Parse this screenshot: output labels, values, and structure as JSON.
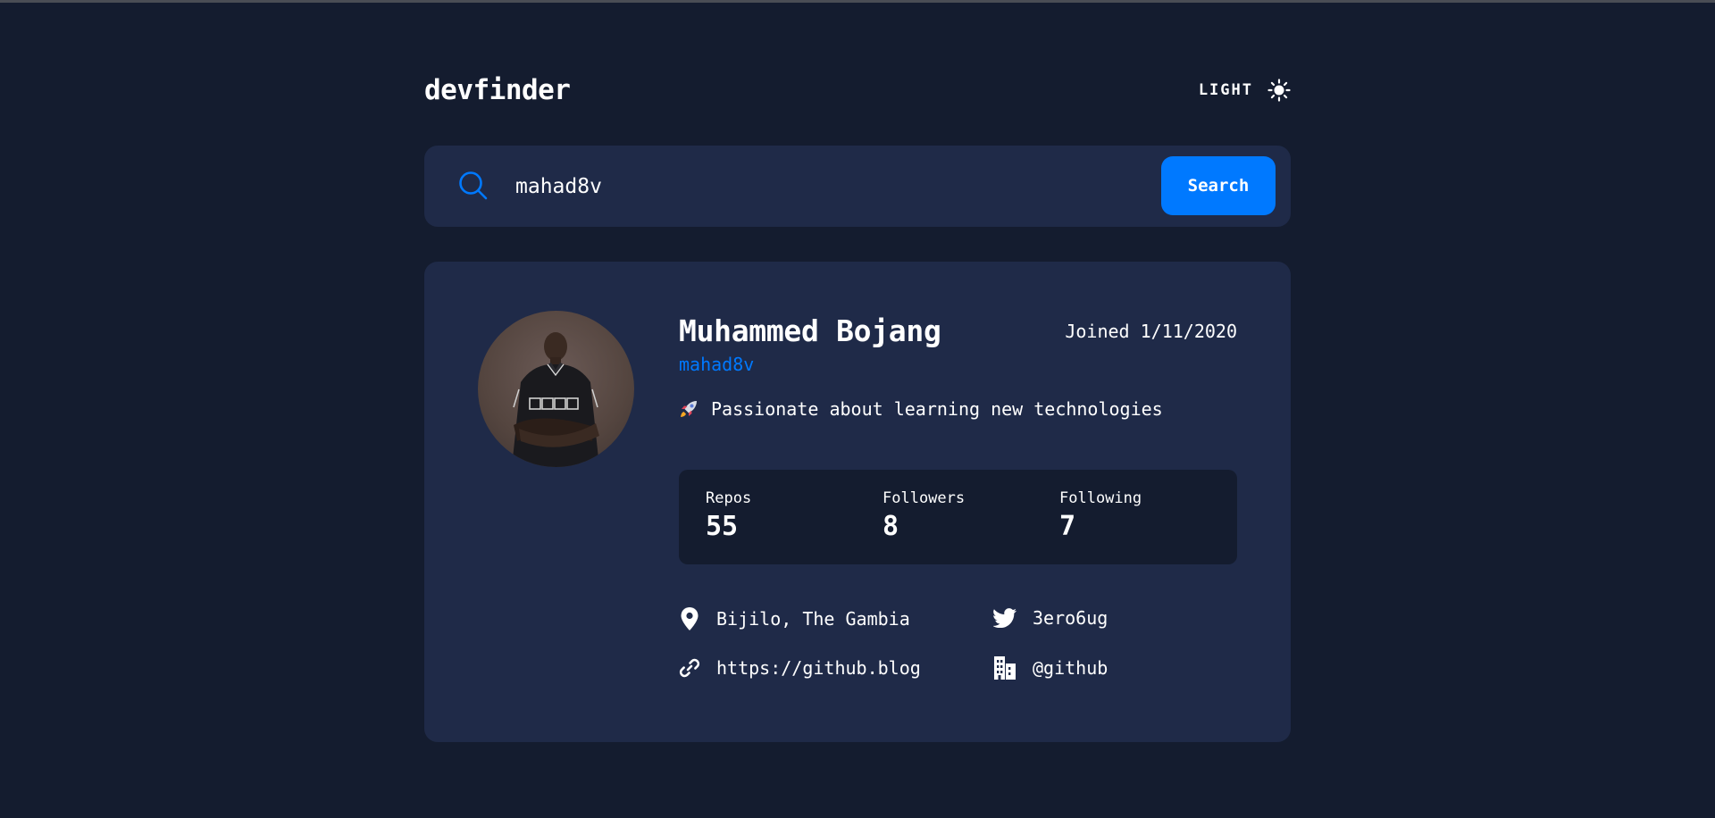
{
  "header": {
    "logo": "devfinder",
    "theme_label": "LIGHT",
    "theme_icon": "sun-icon"
  },
  "search": {
    "value": "mahad8v",
    "button_label": "Search",
    "icon": "search-icon"
  },
  "profile": {
    "name": "Muhammed Bojang",
    "joined": "Joined 1/11/2020",
    "username": "mahad8v",
    "bio": "Passionate about learning new technologies",
    "bio_icon": "rocket-icon",
    "stats": [
      {
        "label": "Repos",
        "value": "55"
      },
      {
        "label": "Followers",
        "value": "8"
      },
      {
        "label": "Following",
        "value": "7"
      }
    ],
    "links": {
      "location": "Bijilo, The Gambia",
      "twitter": "3ero6ug",
      "blog": "https://github.blog",
      "company": "@github"
    }
  },
  "colors": {
    "background": "#141c2f",
    "card": "#1f2a48",
    "accent": "#0079ff",
    "text": "#ffffff"
  }
}
